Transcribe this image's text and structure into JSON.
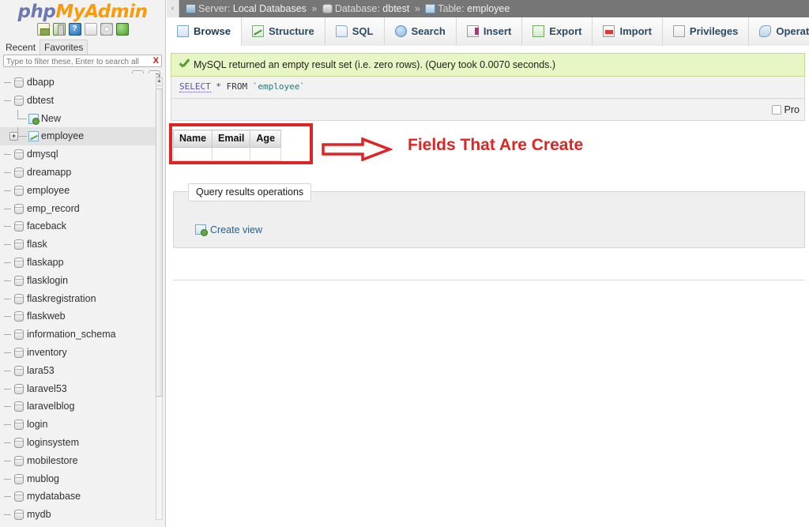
{
  "brand": {
    "name_php": "php",
    "name_my": "My",
    "name_admin": "Admin",
    "icons": [
      "home-icon",
      "exit-icon",
      "docs-icon",
      "wiki-icon",
      "settings-icon",
      "reload-icon"
    ],
    "docs_glyph": "?"
  },
  "sidebar": {
    "nav_tabs": [
      {
        "label": "Recent",
        "boxed": false
      },
      {
        "label": "Favorites",
        "boxed": true
      }
    ],
    "filter": {
      "placeholder": "Type to filter these, Enter to search all",
      "value": "",
      "clear_label": "X"
    },
    "tree_tools": [
      "collapse-all-icon",
      "link-with-main-icon"
    ],
    "scrollbar": {
      "up_glyph": "▲"
    },
    "items": [
      {
        "label": "dbapp",
        "type": "database",
        "expander": null,
        "selected": false
      },
      {
        "label": "dbtest",
        "type": "database",
        "expander": null,
        "selected": false
      },
      {
        "label": "New",
        "type": "new-table",
        "indent": true,
        "selected": false
      },
      {
        "label": "employee",
        "type": "table",
        "indent": true,
        "expander": "+",
        "selected": true
      },
      {
        "label": "dmysql",
        "type": "database",
        "expander": null,
        "selected": false
      },
      {
        "label": "dreamapp",
        "type": "database",
        "expander": null,
        "selected": false
      },
      {
        "label": "employee",
        "type": "database",
        "expander": null,
        "selected": false
      },
      {
        "label": "emp_record",
        "type": "database",
        "expander": null,
        "selected": false
      },
      {
        "label": "faceback",
        "type": "database",
        "expander": null,
        "selected": false
      },
      {
        "label": "flask",
        "type": "database",
        "expander": null,
        "selected": false
      },
      {
        "label": "flaskapp",
        "type": "database",
        "expander": null,
        "selected": false
      },
      {
        "label": "flasklogin",
        "type": "database",
        "expander": null,
        "selected": false
      },
      {
        "label": "flaskregistration",
        "type": "database",
        "expander": null,
        "selected": false
      },
      {
        "label": "flaskweb",
        "type": "database",
        "expander": null,
        "selected": false
      },
      {
        "label": "information_schema",
        "type": "database",
        "expander": null,
        "selected": false
      },
      {
        "label": "inventory",
        "type": "database",
        "expander": null,
        "selected": false
      },
      {
        "label": "lara53",
        "type": "database",
        "expander": null,
        "selected": false
      },
      {
        "label": "laravel53",
        "type": "database",
        "expander": null,
        "selected": false
      },
      {
        "label": "laravelblog",
        "type": "database",
        "expander": null,
        "selected": false
      },
      {
        "label": "login",
        "type": "database",
        "expander": null,
        "selected": false
      },
      {
        "label": "loginsystem",
        "type": "database",
        "expander": null,
        "selected": false
      },
      {
        "label": "mobilestore",
        "type": "database",
        "expander": null,
        "selected": false
      },
      {
        "label": "mublog",
        "type": "database",
        "expander": null,
        "selected": false
      },
      {
        "label": "mydatabase",
        "type": "database",
        "expander": null,
        "selected": false
      },
      {
        "label": "mydb",
        "type": "database",
        "expander": null,
        "selected": false
      }
    ]
  },
  "topbar": {
    "collapse_glyph": "‹",
    "breadcrumb": {
      "server_label": "Server:",
      "server_value": "Local Databases",
      "database_label": "Database:",
      "database_value": "dbtest",
      "table_label": "Table:",
      "table_value": "employee",
      "separator": "»"
    }
  },
  "tabs": [
    {
      "label": "Browse",
      "icon": "browse-icon",
      "active": true
    },
    {
      "label": "Structure",
      "icon": "structure-icon",
      "active": false
    },
    {
      "label": "SQL",
      "icon": "sql-icon",
      "active": false
    },
    {
      "label": "Search",
      "icon": "search-icon",
      "active": false
    },
    {
      "label": "Insert",
      "icon": "insert-icon",
      "active": false
    },
    {
      "label": "Export",
      "icon": "export-icon",
      "active": false
    },
    {
      "label": "Import",
      "icon": "import-icon",
      "active": false
    },
    {
      "label": "Privileges",
      "icon": "privileges-icon",
      "active": false
    },
    {
      "label": "Operations",
      "icon": "operations-icon",
      "active": false
    }
  ],
  "result": {
    "message": "MySQL returned an empty result set (i.e. zero rows). (Query took 0.0070 seconds.)",
    "sql": {
      "keyword": "SELECT",
      "star": "*",
      "from": "FROM",
      "identifier": "`employee`"
    },
    "profiling_label": "Pro",
    "profiling_checked": false
  },
  "results_table": {
    "columns": [
      "Name",
      "Email",
      "Age"
    ],
    "rows": []
  },
  "annotation": {
    "text": "Fields That Are Create",
    "color": "#e02424"
  },
  "query_operations": {
    "legend": "Query results operations",
    "create_view_label": "Create view"
  },
  "colors": {
    "accent": "#2b4a63",
    "banner_bg": "#e8f5c5",
    "banner_border": "#c6d88f",
    "topbar_bg": "#767676",
    "annotation_red": "#e02424",
    "brand_orange": "#f89c0e",
    "brand_blue": "#6c78af"
  }
}
